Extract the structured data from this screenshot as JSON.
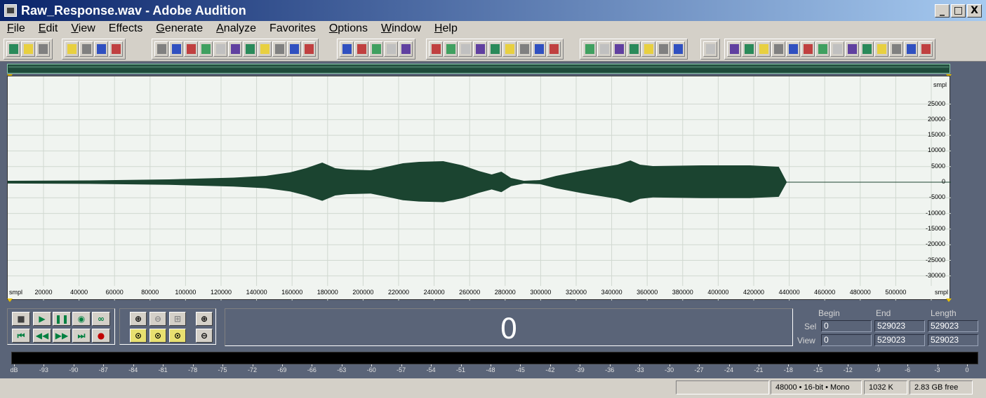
{
  "window": {
    "title": "Raw_Response.wav - Adobe Audition",
    "minimize": "_",
    "maximize": "□",
    "close": "X"
  },
  "menu": [
    "File",
    "Edit",
    "View",
    "Effects",
    "Generate",
    "Analyze",
    "Favorites",
    "Options",
    "Window",
    "Help"
  ],
  "toolbar_icons": [
    "multitrack-view-icon",
    "edit-view-icon",
    "cd-view-icon",
    "new-icon",
    "open-icon",
    "close-icon",
    "save-icon",
    "save-all-icon",
    "undo-icon",
    "redo-icon",
    "repeat-icon",
    "copy-new-icon",
    "copy-icon",
    "cut-icon",
    "paste-icon",
    "paste-new-icon",
    "mix-paste-icon",
    "trim-icon",
    "normalize-icon",
    "amplify-icon",
    "fade-icon",
    "envelope-icon",
    "delay-icon",
    "reverb-icon",
    "spectral-view-icon",
    "waveform-view-icon",
    "playlist-icon",
    "zoom-icon",
    "time-format-icon",
    "grid-icon",
    "colors-icon",
    "fit-icon",
    "generate-icon",
    "irs-icon",
    "mls-icon",
    "sweep-icon",
    "analyzer-icon",
    "record-icon",
    "noise-icon",
    "meter-icon",
    "ap4-icon",
    "ap42-icon",
    "mq-icon",
    "varp-icon",
    "filter-icon",
    "sweep2-icon",
    "ff-icon",
    "bar-red-icon",
    "bands-icon",
    "rt-icon",
    "tc-icon",
    "itu-p56-icon",
    "sti-icon",
    "ff2-icon"
  ],
  "wave": {
    "y_unit": "smpl",
    "y_ticks": [
      "25000",
      "20000",
      "15000",
      "10000",
      "5000",
      "0",
      "-5000",
      "-10000",
      "-15000",
      "-20000",
      "-25000",
      "-30000"
    ],
    "x_unit_left": "smpl",
    "x_unit_right": "smpl",
    "x_ticks": [
      "20000",
      "40000",
      "60000",
      "80000",
      "100000",
      "120000",
      "140000",
      "160000",
      "180000",
      "200000",
      "220000",
      "240000",
      "260000",
      "280000",
      "300000",
      "320000",
      "340000",
      "360000",
      "380000",
      "400000",
      "420000",
      "440000",
      "460000",
      "480000",
      "500000"
    ],
    "color": "#1b4430",
    "bg": "#f0f4f0"
  },
  "transport": {
    "time": "0"
  },
  "selection": {
    "begin_label": "Begin",
    "end_label": "End",
    "length_label": "Length",
    "sel_label": "Sel",
    "view_label": "View",
    "sel_begin": "0",
    "sel_end": "529023",
    "sel_length": "529023",
    "view_begin": "0",
    "view_end": "529023",
    "view_length": "529023"
  },
  "meter": {
    "ticks": [
      "dB",
      "-93",
      "-90",
      "-87",
      "-84",
      "-81",
      "-78",
      "-75",
      "-72",
      "-69",
      "-66",
      "-63",
      "-60",
      "-57",
      "-54",
      "-51",
      "-48",
      "-45",
      "-42",
      "-39",
      "-36",
      "-33",
      "-30",
      "-27",
      "-24",
      "-21",
      "-18",
      "-15",
      "-12",
      "-9",
      "-6",
      "-3",
      "0"
    ]
  },
  "status": {
    "format": "48000 • 16-bit • Mono",
    "size": "1032 K",
    "free": "2.83 GB free"
  }
}
